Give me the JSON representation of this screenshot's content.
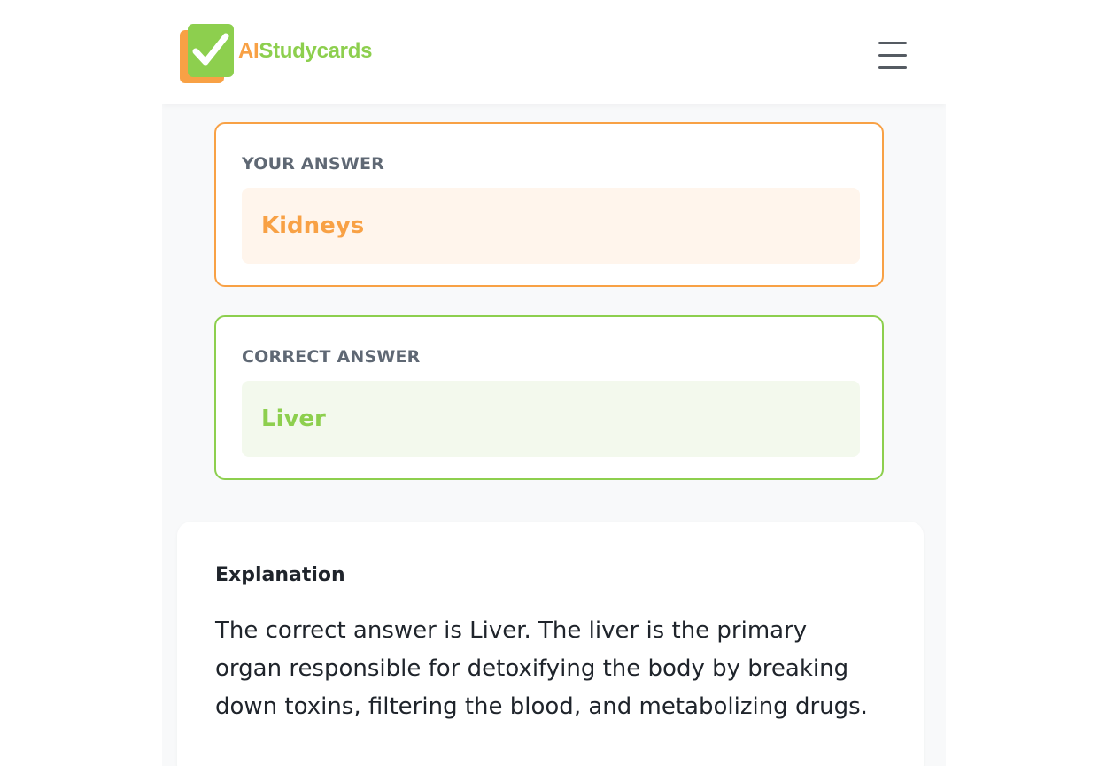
{
  "header": {
    "brand_ai": "AI",
    "brand_rest": "Studycards",
    "menu_icon": "hamburger-menu-icon",
    "logo_icon": "checkmark-cards-icon"
  },
  "your_answer": {
    "label": "YOUR ANSWER",
    "value": "Kidneys"
  },
  "correct_answer": {
    "label": "CORRECT ANSWER",
    "value": "Liver"
  },
  "explanation": {
    "title": "Explanation",
    "text": "The correct answer is Liver. The liver is the primary organ responsible for detoxifying the body by breaking down toxins, filtering the blood, and metabolizing drugs."
  },
  "colors": {
    "brand_orange": "#f8a145",
    "brand_green": "#8dcf4e",
    "background": "#f8f9fa"
  }
}
